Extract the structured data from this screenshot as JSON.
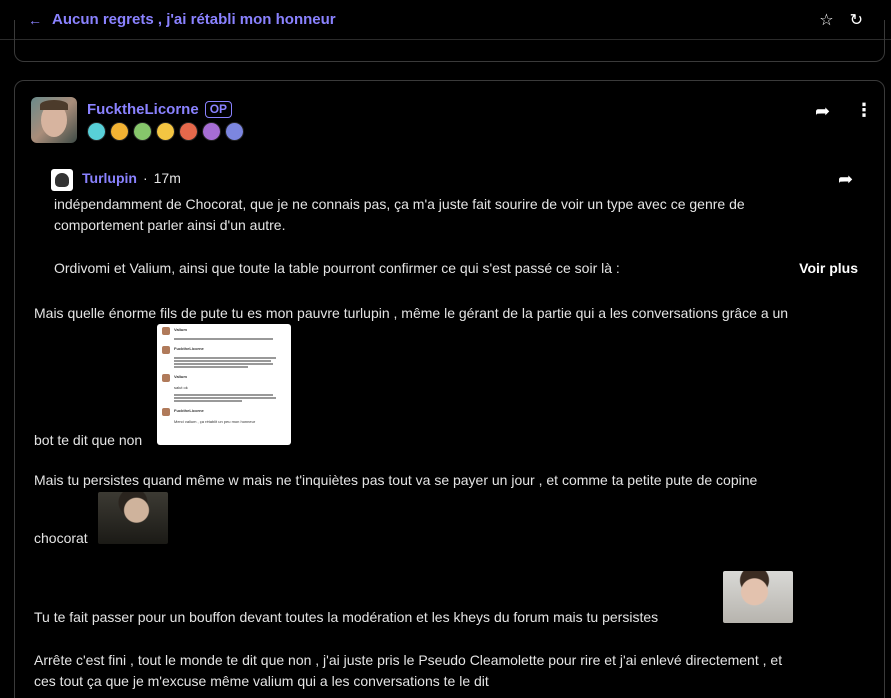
{
  "topbar": {
    "title": "Aucun regrets , j'ai rétabli mon honneur",
    "icons": [
      "back-arrow-icon",
      "star-icon",
      "refresh-icon"
    ]
  },
  "post": {
    "author": "FucktheLicorne",
    "op_label": "OP",
    "badge_colors": [
      "#58d0d8",
      "#f2b233",
      "#86c66b",
      "#f4c542",
      "#e5684b",
      "#a66dd4",
      "#7c86e0"
    ],
    "quote": {
      "author": "Turlupin",
      "separator": "·",
      "time": "17m",
      "lines": [
        "indépendamment de Chocorat, que je ne connais pas, ça m'a juste fait sourire de voir un type avec ce genre de",
        "comportement parler ainsi d'un autre.",
        "Ordivomi et Valium, ainsi que toute la table pourront confirmer ce qui s'est passé ce soir là :"
      ],
      "more_label": "Voir plus"
    },
    "body": {
      "p1": "Mais quelle énorme fils de pute tu es mon pauvre turlupin , même le gérant de la partie qui a les conversations grâce a un",
      "p2": "bot te dit que non",
      "p3": "Mais tu persistes quand même w mais ne t'inquiètes pas tout va se payer un jour , et comme ta petite pute de copine",
      "p4": "chocorat",
      "p5": "Tu te fait passer pour un bouffon devant toutes la modération et les kheys du forum mais tu persistes",
      "p6a": "Arrête c'est fini , tout le monde te dit que non , j'ai juste pris le Pseudo Cleamolette pour rire et j'ai enlevé directement , et",
      "p6b": "ces tout ça que je m'excuse même valium qui a les conversations te le dit"
    },
    "screenshot": {
      "names": [
        "Valium",
        "FucktheLicorne",
        "Valium",
        "FucktheLicorne"
      ],
      "replies": [
        "salut ok",
        "Merci valium , ça rétablit un peu mon honneur"
      ]
    }
  }
}
